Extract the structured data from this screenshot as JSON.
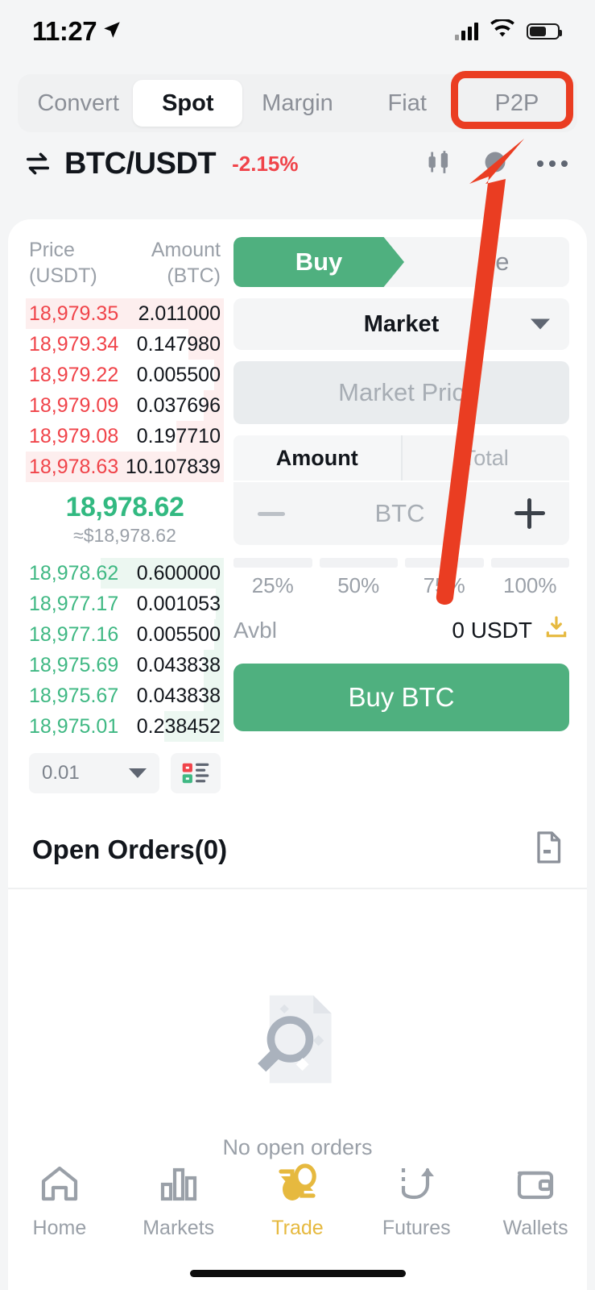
{
  "status_bar": {
    "time": "11:27",
    "location_icon": "location-arrow-icon",
    "signal_icon": "cellular-signal-icon",
    "wifi_icon": "wifi-icon",
    "battery_icon": "battery-icon"
  },
  "top_tabs": {
    "items": [
      {
        "label": "Convert",
        "active": false
      },
      {
        "label": "Spot",
        "active": true
      },
      {
        "label": "Margin",
        "active": false
      },
      {
        "label": "Fiat",
        "active": false
      },
      {
        "label": "P2P",
        "active": false
      }
    ],
    "highlighted": "P2P"
  },
  "pair_header": {
    "swap_icon": "swap-arrows-icon",
    "pair": "BTC/USDT",
    "change": "-2.15%",
    "change_color": "#f0444a",
    "chart_icon": "candlestick-chart-icon",
    "more_icon": "more-options-icon"
  },
  "order_book": {
    "col_price_line1": "Price",
    "col_price_line2": "(USDT)",
    "col_amount_line1": "Amount",
    "col_amount_line2": "(BTC)",
    "asks": [
      {
        "price": "18,979.35",
        "amount": "2.011000",
        "depth": 100
      },
      {
        "price": "18,979.34",
        "amount": "0.147980",
        "depth": 18
      },
      {
        "price": "18,979.22",
        "amount": "0.005500",
        "depth": 5
      },
      {
        "price": "18,979.09",
        "amount": "0.037696",
        "depth": 10
      },
      {
        "price": "18,979.08",
        "amount": "0.197710",
        "depth": 24
      },
      {
        "price": "18,978.63",
        "amount": "10.107839",
        "depth": 100
      }
    ],
    "bids": [
      {
        "price": "18,978.62",
        "amount": "0.600000",
        "depth": 62
      },
      {
        "price": "18,977.17",
        "amount": "0.001053",
        "depth": 4
      },
      {
        "price": "18,977.16",
        "amount": "0.005500",
        "depth": 5
      },
      {
        "price": "18,975.69",
        "amount": "0.043838",
        "depth": 10
      },
      {
        "price": "18,975.67",
        "amount": "0.043838",
        "depth": 10
      },
      {
        "price": "18,975.01",
        "amount": "0.238452",
        "depth": 30
      }
    ],
    "mid_price": "18,978.62",
    "mid_price_usd": "≈$18,978.62",
    "mid_price_color": "#32b981",
    "tick_size": "0.01",
    "tick_caret_icon": "chevron-down-icon",
    "depth_view_icon": "orderbook-layout-icon",
    "ask_color": "#f0444a",
    "bid_color": "#3fb883"
  },
  "order_form": {
    "buy_label": "Buy",
    "sell_label": "Se",
    "order_type": "Market",
    "order_type_caret": "chevron-down-icon",
    "price_placeholder": "Market Pric",
    "amount_tab": "Amount",
    "total_tab": "Total",
    "minus_icon": "minus-icon",
    "unit": "BTC",
    "plus_icon": "plus-icon",
    "percentages": [
      "25%",
      "50%",
      "75%",
      "100%"
    ],
    "avbl_label": "Avbl",
    "avbl_value": "0 USDT",
    "deposit_icon": "deposit-download-icon",
    "submit_label": "Buy BTC",
    "buy_color": "#4fb07f"
  },
  "open_orders": {
    "title": "Open Orders(0)",
    "doc_icon": "order-history-document-icon",
    "empty_icon": "no-results-document-search-icon",
    "empty_text": "No open orders"
  },
  "bottom_nav": {
    "items": [
      {
        "label": "Home",
        "icon": "home-icon",
        "active": false
      },
      {
        "label": "Markets",
        "icon": "bar-chart-icon",
        "active": false
      },
      {
        "label": "Trade",
        "icon": "trade-swap-icon",
        "active": true
      },
      {
        "label": "Futures",
        "icon": "futures-arrow-icon",
        "active": false
      },
      {
        "label": "Wallets",
        "icon": "wallet-icon",
        "active": false
      }
    ],
    "active_color": "#e6b93f"
  },
  "annotation": {
    "arrow_icon": "pointer-arrow-icon",
    "color": "#ea3d22",
    "target": "P2P"
  }
}
